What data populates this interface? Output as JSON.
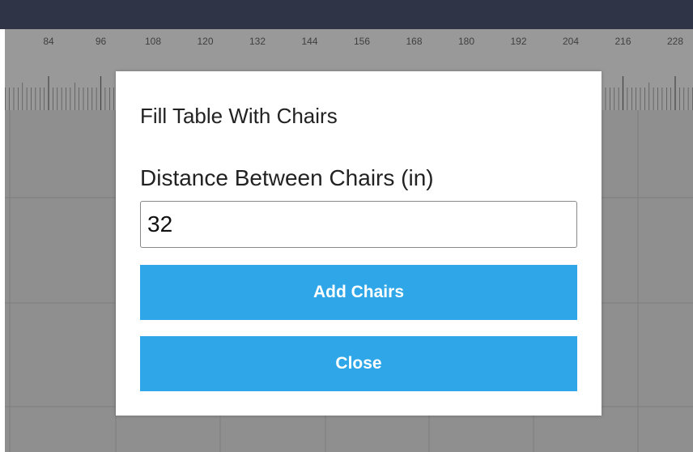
{
  "ruler": {
    "labels": [
      "84",
      "96",
      "108",
      "120",
      "132",
      "144",
      "156",
      "168",
      "180",
      "192",
      "204",
      "216",
      "228"
    ]
  },
  "dialog": {
    "title": "Fill Table With Chairs",
    "distance_label": "Distance Between Chairs (in)",
    "distance_value": "32",
    "add_button": "Add Chairs",
    "close_button": "Close"
  },
  "colors": {
    "topbar": "#2f3446",
    "workspace": "#8f8f8f",
    "ruler": "#999999",
    "button": "#2ea6e8"
  }
}
